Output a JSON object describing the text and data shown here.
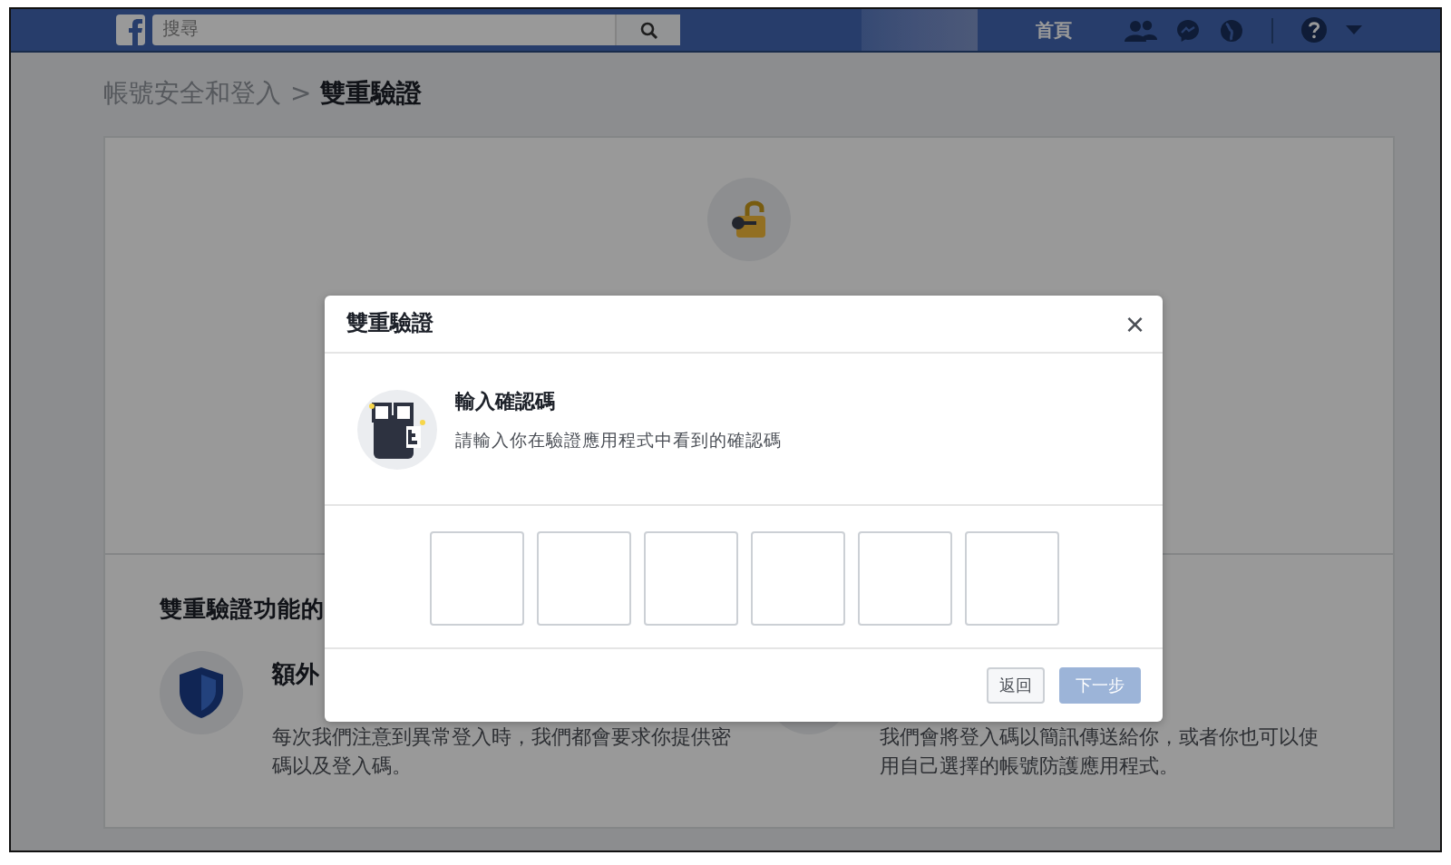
{
  "top_bar": {
    "search": {
      "placeholder": "搜尋"
    },
    "nav": [
      {
        "label": "首頁"
      }
    ]
  },
  "breadcrumb": {
    "parent": "帳號安全和登入",
    "separator": ">",
    "current": "雙重驗證"
  },
  "section": {
    "heading": "雙重驗證功能的",
    "features": [
      {
        "title": "額外",
        "lines": [
          "每次我們注意到異常登入時，我們都會要求你提供密",
          "碼以及登入碼。"
        ]
      },
      {
        "lines": [
          "我們會將登入碼以簡訊傳送給你，或者你也可以使",
          "用自己選擇的帳號防護應用程式。"
        ]
      }
    ]
  },
  "dialog": {
    "title": "雙重驗證",
    "close": "×",
    "step_title": "輸入確認碼",
    "step_text": "請輸入你在驗證應用程式中看到的確認碼",
    "code_inputs": [
      {
        "kind": "digit"
      },
      {
        "kind": "digit"
      },
      {
        "kind": "digit"
      },
      {
        "kind": "digit"
      },
      {
        "kind": "digit"
      },
      {
        "kind": "digit"
      }
    ],
    "buttons": [
      {
        "label": "返回",
        "kind": "secondary",
        "disabled": false
      },
      {
        "label": "下一步",
        "kind": "primary",
        "disabled": true
      }
    ]
  }
}
